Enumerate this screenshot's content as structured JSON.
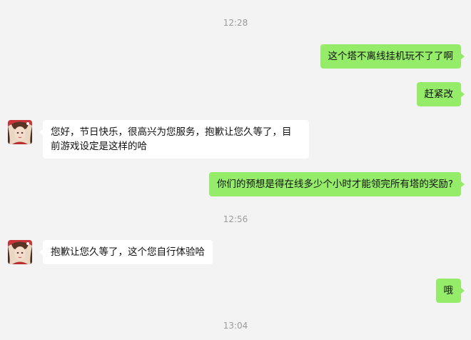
{
  "timestamps": [
    "12:28",
    "12:56",
    "13:04"
  ],
  "messages": [
    {
      "side": "out",
      "text": "这个塔不离线挂机玩不了了啊"
    },
    {
      "side": "out",
      "text": "赶紧改"
    },
    {
      "side": "in",
      "lines": [
        "您好，节日快乐，很高兴为您服务，抱歉让您久等了，目",
        "前游戏设定是这样的哈"
      ]
    },
    {
      "side": "out",
      "text": "你们的预想是得在线多少个小时才能领完所有塔的奖励?"
    },
    {
      "side": "in",
      "text": "抱歉让您久等了，这个您自行体验哈"
    },
    {
      "side": "out",
      "text": "哦"
    }
  ],
  "avatar": {
    "icon": "support-agent-avatar-icon",
    "accent": "#c8353a"
  },
  "colors": {
    "out_bubble": "#95ec69",
    "in_bubble": "#ffffff",
    "background": "#f3f3f3"
  }
}
